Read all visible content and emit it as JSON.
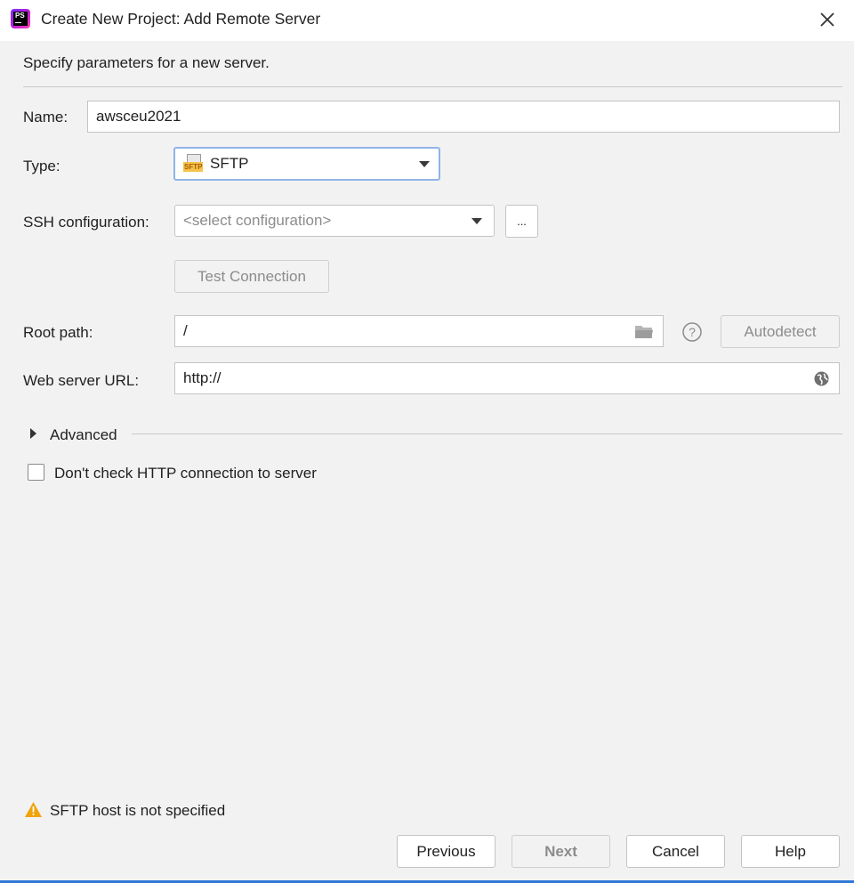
{
  "window": {
    "title": "Create New Project: Add Remote Server",
    "app_icon_text": "PS"
  },
  "subtitle": "Specify parameters for a new server.",
  "form": {
    "name_label": "Name:",
    "name_value": "awsceu2021",
    "type_label": "Type:",
    "type_value": "SFTP",
    "type_icon_text": "SFTP",
    "ssh_label": "SSH configuration:",
    "ssh_placeholder": "<select configuration>",
    "ssh_more_label": "...",
    "test_connection_label": "Test Connection",
    "root_path_label": "Root path:",
    "root_path_value": "/",
    "autodetect_label": "Autodetect",
    "web_url_label": "Web server URL:",
    "web_url_value": "http://",
    "advanced_label": "Advanced",
    "dont_check_label": "Don't check HTTP connection to server",
    "dont_check_checked": false
  },
  "warning": {
    "text": "SFTP host is not specified",
    "color": "#f0a30a"
  },
  "buttons": {
    "previous": "Previous",
    "next": "Next",
    "cancel": "Cancel",
    "help": "Help"
  },
  "colors": {
    "background": "#f2f2f2",
    "focus_border": "#8fb4e8",
    "accent_line": "#2f78d6"
  }
}
